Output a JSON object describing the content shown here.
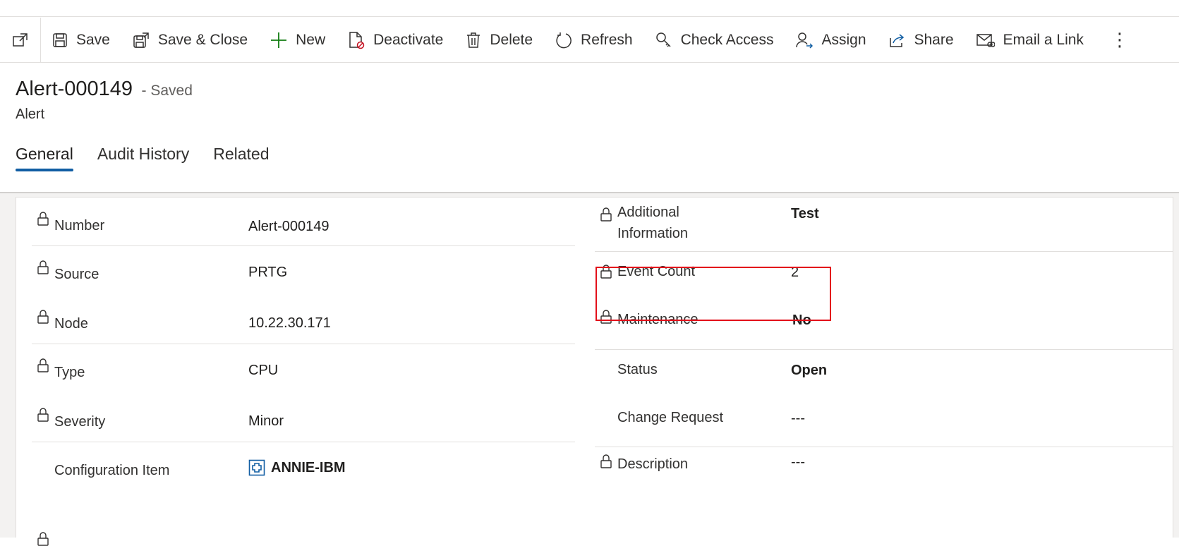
{
  "toolbar": {
    "buttons": [
      {
        "label": "Save",
        "icon": "save-icon"
      },
      {
        "label": "Save & Close",
        "icon": "save-close-icon"
      },
      {
        "label": "New",
        "icon": "plus-icon"
      },
      {
        "label": "Deactivate",
        "icon": "deactivate-icon"
      },
      {
        "label": "Delete",
        "icon": "trash-icon"
      },
      {
        "label": "Refresh",
        "icon": "refresh-icon"
      },
      {
        "label": "Check Access",
        "icon": "key-search-icon"
      },
      {
        "label": "Assign",
        "icon": "assign-icon"
      },
      {
        "label": "Share",
        "icon": "share-icon"
      },
      {
        "label": "Email a Link",
        "icon": "email-link-icon"
      }
    ],
    "more": "⋮"
  },
  "record": {
    "title": "Alert-000149",
    "saved_status": "- Saved",
    "entity": "Alert"
  },
  "tabs": [
    {
      "label": "General",
      "active": true
    },
    {
      "label": "Audit History",
      "active": false
    },
    {
      "label": "Related",
      "active": false
    }
  ],
  "left_fields": [
    {
      "label": "Number",
      "value": "Alert-000149",
      "locked": true
    },
    {
      "label": "Source",
      "value": "PRTG",
      "locked": true
    },
    {
      "label": "Node",
      "value": "10.22.30.171",
      "locked": true
    },
    {
      "label": "Type",
      "value": "CPU",
      "locked": true
    },
    {
      "label": "Severity",
      "value": "Minor",
      "locked": true
    },
    {
      "label": "Configuration Item",
      "value": "ANNIE-IBM",
      "locked": false
    }
  ],
  "right_fields": [
    {
      "label": "Additional\nInformation",
      "value": "Test",
      "locked": true
    },
    {
      "label": "Event Count",
      "value": "2",
      "locked": true
    },
    {
      "label": "Maintenance",
      "value": "No",
      "locked": true
    },
    {
      "label": "Status",
      "value": "Open",
      "locked": false
    },
    {
      "label": "Change Request",
      "value": "---",
      "locked": false
    },
    {
      "label": "Description",
      "value": "---",
      "locked": true
    }
  ],
  "colors": {
    "accent": "#115ea3",
    "highlight": "#e3101a"
  }
}
